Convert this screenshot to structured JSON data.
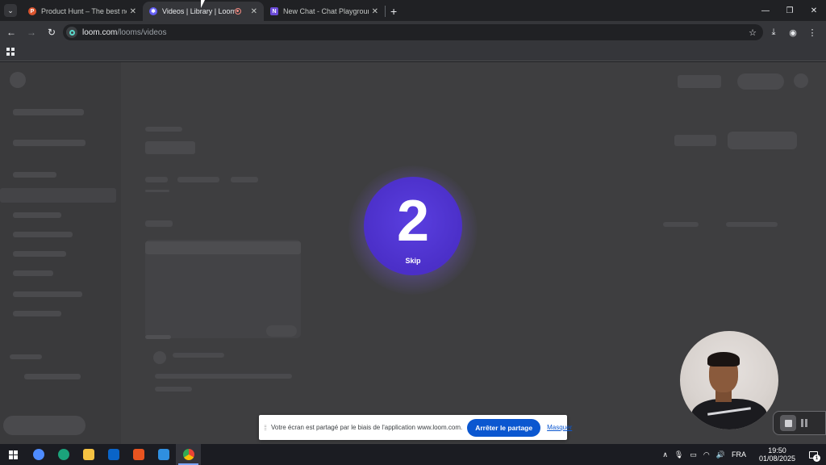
{
  "browser": {
    "tabs": [
      {
        "title": "Product Hunt – The best new p",
        "favicon_letter": "P",
        "favicon_color": "#da552f",
        "active": false
      },
      {
        "title": "Videos | Library | Loom",
        "favicon_letter": "✱",
        "favicon_color": "#625df5",
        "active": true,
        "recording": true
      },
      {
        "title": "New Chat - Chat Playground",
        "favicon_letter": "N",
        "favicon_color": "#6b4bd8",
        "active": false
      }
    ],
    "new_tab_symbol": "+",
    "address": {
      "host": "loom.com",
      "path": "/looms/videos"
    },
    "window_controls": {
      "minimize": "—",
      "restore": "❐",
      "close": "✕"
    }
  },
  "countdown": {
    "number": "2",
    "skip_label": "Skip",
    "color": "#5a3fe0"
  },
  "share_banner": {
    "grip": "⁞⁞",
    "message": "Votre écran est partagé par le biais de l'application www.loom.com.",
    "stop_label": "Arrêter le partage",
    "hide_label": "Masquer"
  },
  "taskbar": {
    "apps": [
      {
        "name": "copilot",
        "color": "#4e8cff"
      },
      {
        "name": "edge",
        "color": "#1ba37b"
      },
      {
        "name": "file-explorer",
        "color": "#f5c242"
      },
      {
        "name": "outlook",
        "color": "#0a64c8"
      },
      {
        "name": "ubuntu",
        "color": "#e95420"
      },
      {
        "name": "vscode",
        "color": "#2f8fe0"
      },
      {
        "name": "chrome",
        "color": "#e8b32a",
        "active": true
      }
    ],
    "tray": {
      "chevron": "∧",
      "mic": "🎙",
      "battery": "▭",
      "network": "◠",
      "volume": "🔊",
      "language": "FRA",
      "time": "19:50",
      "date": "01/08/2025",
      "notification_count": "1"
    }
  }
}
